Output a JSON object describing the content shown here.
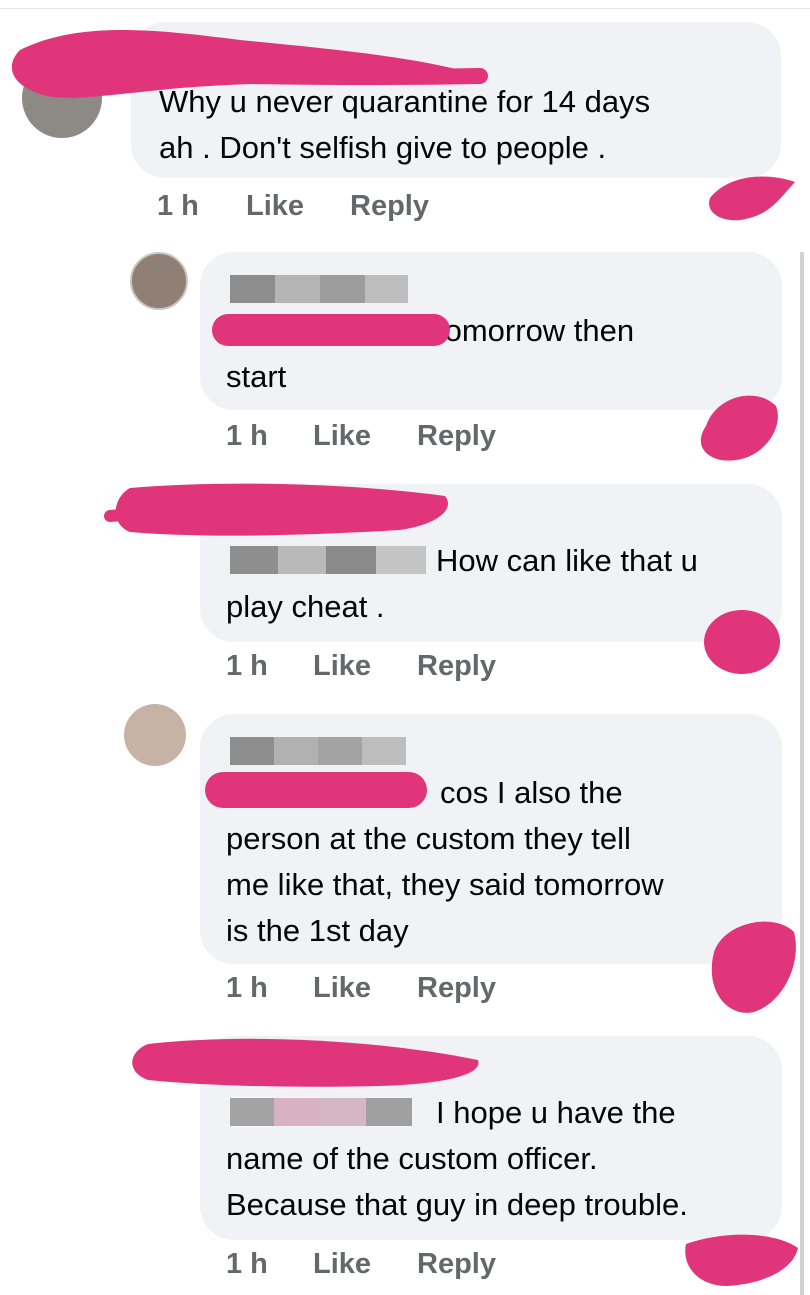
{
  "comments": [
    {
      "lines": [
        "Why u never quarantine  for 14 days",
        "ah . Don't selfish  give to people ."
      ],
      "time": "1 h",
      "like": "Like",
      "reply": "Reply"
    },
    {
      "lines": [
        "tomorrow then",
        "start"
      ],
      "time": "1 h",
      "like": "Like",
      "reply": "Reply"
    },
    {
      "lines": [
        "How can like that u",
        "play cheat ."
      ],
      "time": "1 h",
      "like": "Like",
      "reply": "Reply"
    },
    {
      "lines": [
        "cos I also the",
        "person at the custom they tell",
        "me like that, they said tomorrow",
        "is the 1st day"
      ],
      "time": "1 h",
      "like": "Like",
      "reply": "Reply"
    },
    {
      "lines": [
        "I hope u have the",
        "name of the custom officer.",
        "Because that guy in deep trouble."
      ],
      "time": "1 h",
      "like": "Like",
      "reply": "Reply"
    }
  ],
  "colors": {
    "bubble": "#f0f2f5",
    "action_text": "#65676b",
    "redaction": "#e0357a"
  }
}
